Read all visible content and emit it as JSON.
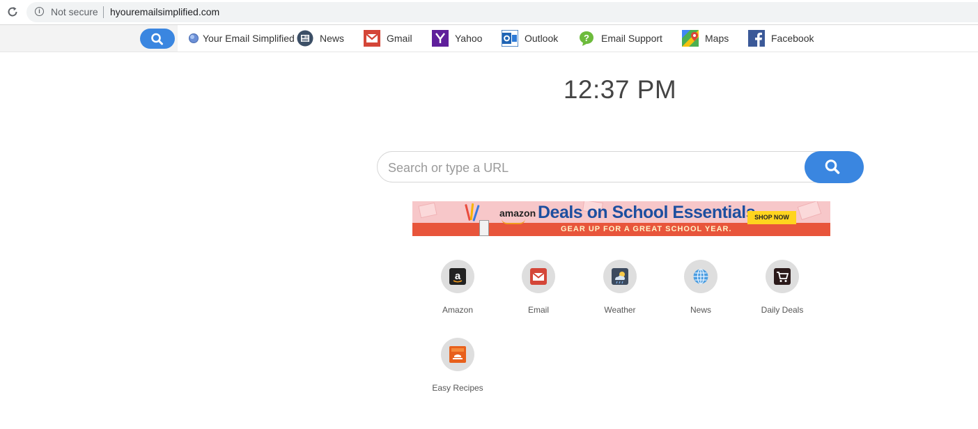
{
  "browser": {
    "security_label": "Not secure",
    "url": "hyouremailsimplified.com"
  },
  "toolbar": {
    "items": [
      {
        "label": "Your Email Simplified",
        "icon": "globe-icon"
      },
      {
        "label": "News",
        "icon": "news-icon"
      },
      {
        "label": "Gmail",
        "icon": "gmail-icon"
      },
      {
        "label": "Yahoo",
        "icon": "yahoo-icon"
      },
      {
        "label": "Outlook",
        "icon": "outlook-icon"
      },
      {
        "label": "Email Support",
        "icon": "help-icon"
      },
      {
        "label": "Maps",
        "icon": "maps-icon"
      },
      {
        "label": "Facebook",
        "icon": "facebook-icon"
      }
    ]
  },
  "clock": {
    "time": "12:37 PM"
  },
  "search": {
    "placeholder": "Search or type a URL"
  },
  "banner": {
    "brand": "amazon",
    "headline": "Deals on School Essentials",
    "subline": "GEAR UP FOR A GREAT SCHOOL YEAR.",
    "cta": "SHOP NOW"
  },
  "tiles": [
    {
      "label": "Amazon",
      "icon": "amazon-icon"
    },
    {
      "label": "Email",
      "icon": "email-icon"
    },
    {
      "label": "Weather",
      "icon": "weather-icon"
    },
    {
      "label": "News",
      "icon": "globe-icon"
    },
    {
      "label": "Daily Deals",
      "icon": "cart-icon"
    },
    {
      "label": "Easy Recipes",
      "icon": "recipes-icon"
    }
  ],
  "colors": {
    "accent": "#3a86e0",
    "gmail_red": "#d44638",
    "yahoo_purple": "#5f1f9b",
    "outlook_blue": "#1f64b4",
    "facebook_blue": "#3b5998"
  }
}
